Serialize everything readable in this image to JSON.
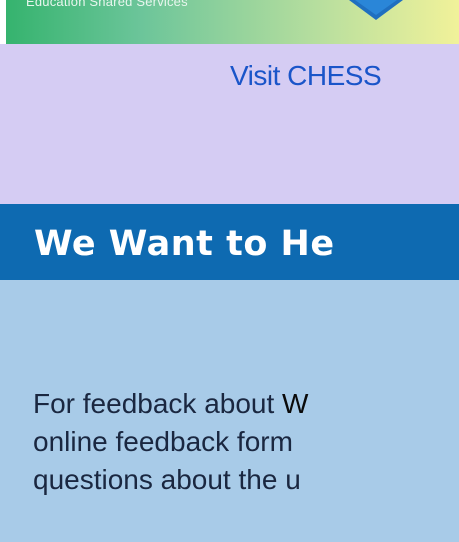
{
  "banner": {
    "subtitle": "Education Shared Services",
    "logo_icon": "shield-logo-icon",
    "gradient": [
      "#35b36e",
      "#f1f29a"
    ]
  },
  "visit": {
    "label": "Visit CHESS"
  },
  "header": {
    "title": "We Want to He"
  },
  "feedback": {
    "line1_prefix": "For feedback about ",
    "line1_emphasis": "W",
    "line2": "online feedback form",
    "line3": "questions about the u"
  },
  "colors": {
    "lavender_band": "#d5ccf3",
    "header_bar": "#0e6ab1",
    "content_bg": "#a8cbe8",
    "link": "#1a55c9"
  }
}
